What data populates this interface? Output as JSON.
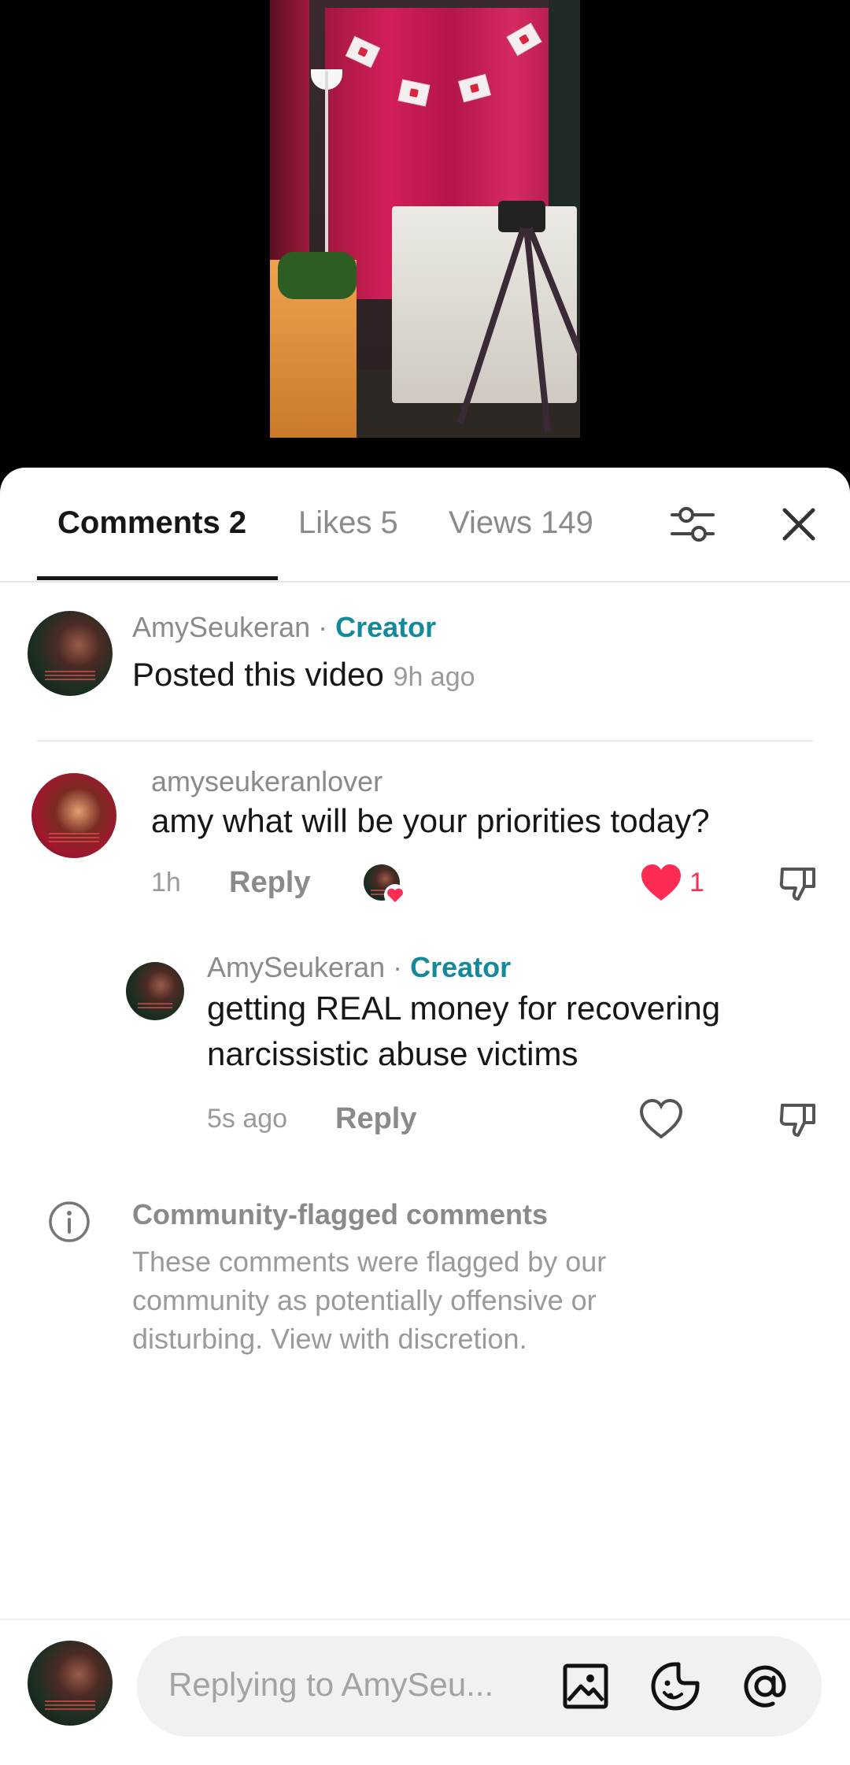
{
  "tabs": {
    "comments": "Comments 2",
    "likes": "Likes 5",
    "views": "Views 149"
  },
  "post": {
    "username": "AmySeukeran",
    "separator": " · ",
    "creator_label": "Creator",
    "text": "Posted this video",
    "time": "9h ago"
  },
  "comments": [
    {
      "username": "amyseukeranlover",
      "text": "amy what will be your priorities today?",
      "time": "1h",
      "reply_label": "Reply",
      "likes": "1",
      "liked": true
    }
  ],
  "reply": {
    "username": "AmySeukeran",
    "separator": " · ",
    "creator_label": "Creator",
    "text": "getting REAL money for recovering narcissistic abuse victims",
    "time": "5s ago",
    "reply_label": "Reply"
  },
  "flagged": {
    "title": "Community-flagged comments",
    "description": "These comments were flagged by our community as potentially offensive or disturbing. View with discretion."
  },
  "input": {
    "placeholder": "Replying to AmySeu..."
  },
  "colors": {
    "accent": "#138a9c",
    "like": "#fe2c55",
    "text": "#161616",
    "muted": "#8a8a8a"
  },
  "icons": [
    "filter-icon",
    "close-icon",
    "heart-icon",
    "dislike-icon",
    "info-icon",
    "image-icon",
    "emoji-icon",
    "mention-icon"
  ]
}
